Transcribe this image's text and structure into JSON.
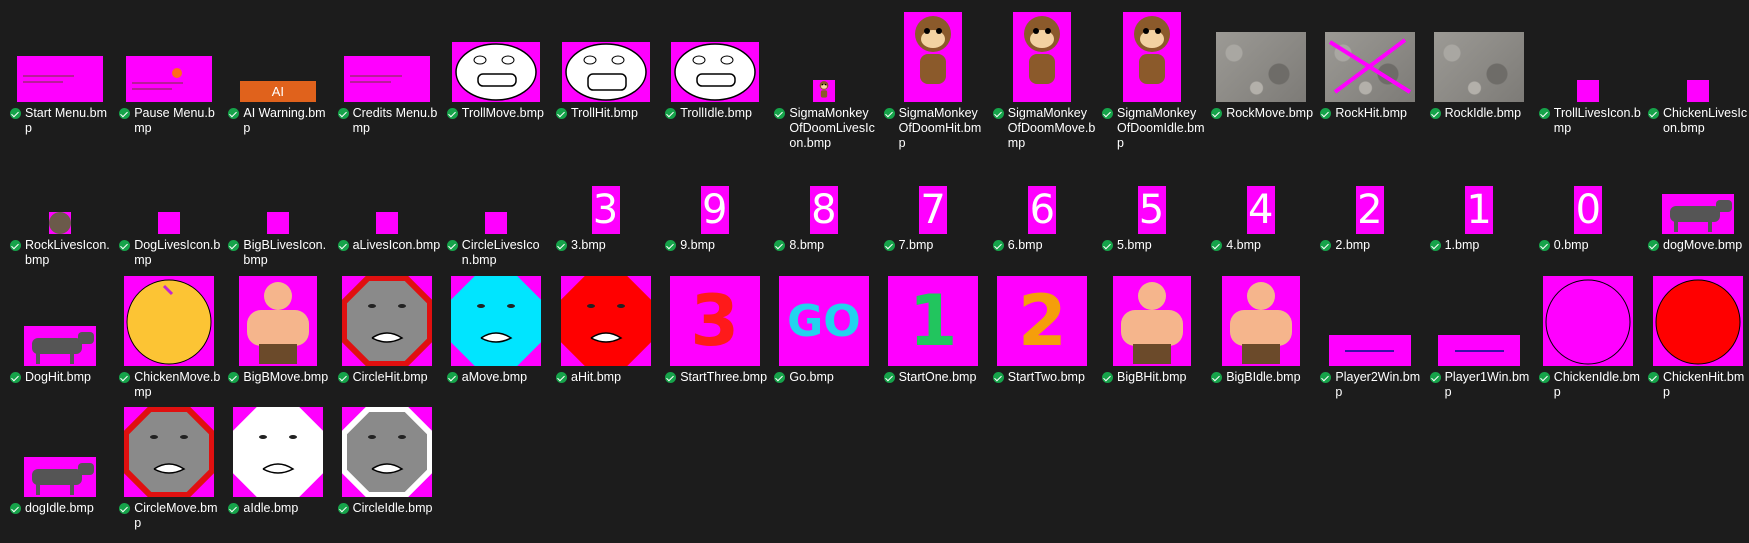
{
  "files": [
    {
      "name": "Start Menu.bmp",
      "thumb": "menu"
    },
    {
      "name": "Pause Menu.bmp",
      "thumb": "pause"
    },
    {
      "name": "AI Warning.bmp",
      "thumb": "ai-warning",
      "text": "AI"
    },
    {
      "name": "Credits Menu.bmp",
      "thumb": "credits"
    },
    {
      "name": "TrollMove.bmp",
      "thumb": "troll"
    },
    {
      "name": "TrollHit.bmp",
      "thumb": "troll-hit"
    },
    {
      "name": "TrollIdle.bmp",
      "thumb": "troll"
    },
    {
      "name": "SigmaMonkeyOfDoomLivesIcon.bmp",
      "thumb": "monkey-small"
    },
    {
      "name": "SigmaMonkeyOfDoomHit.bmp",
      "thumb": "monkey"
    },
    {
      "name": "SigmaMonkeyOfDoomMove.bmp",
      "thumb": "monkey"
    },
    {
      "name": "SigmaMonkeyOfDoomIdle.bmp",
      "thumb": "monkey"
    },
    {
      "name": "RockMove.bmp",
      "thumb": "rock"
    },
    {
      "name": "RockHit.bmp",
      "thumb": "rock-hit"
    },
    {
      "name": "RockIdle.bmp",
      "thumb": "rock"
    },
    {
      "name": "TrollLivesIcon.bmp",
      "thumb": "small"
    },
    {
      "name": "ChickenLivesIcon.bmp",
      "thumb": "small"
    },
    {
      "name": "RockLivesIcon.bmp",
      "thumb": "small-rock"
    },
    {
      "name": "DogLivesIcon.bmp",
      "thumb": "small"
    },
    {
      "name": "BigBLivesIcon.bmp",
      "thumb": "small"
    },
    {
      "name": "aLivesIcon.bmp",
      "thumb": "small"
    },
    {
      "name": "CircleLivesIcon.bmp",
      "thumb": "small"
    },
    {
      "name": "3.bmp",
      "thumb": "digit",
      "text": "3"
    },
    {
      "name": "9.bmp",
      "thumb": "digit",
      "text": "9"
    },
    {
      "name": "8.bmp",
      "thumb": "digit",
      "text": "8"
    },
    {
      "name": "7.bmp",
      "thumb": "digit",
      "text": "7"
    },
    {
      "name": "6.bmp",
      "thumb": "digit",
      "text": "6"
    },
    {
      "name": "5.bmp",
      "thumb": "digit",
      "text": "5"
    },
    {
      "name": "4.bmp",
      "thumb": "digit",
      "text": "4"
    },
    {
      "name": "2.bmp",
      "thumb": "digit",
      "text": "2"
    },
    {
      "name": "1.bmp",
      "thumb": "digit",
      "text": "1"
    },
    {
      "name": "0.bmp",
      "thumb": "digit",
      "text": "0"
    },
    {
      "name": "dogMove.bmp",
      "thumb": "dog"
    },
    {
      "name": "DogHit.bmp",
      "thumb": "dog"
    },
    {
      "name": "ChickenMove.bmp",
      "thumb": "chicken"
    },
    {
      "name": "BigBMove.bmp",
      "thumb": "bigb"
    },
    {
      "name": "CircleHit.bmp",
      "thumb": "circle-red"
    },
    {
      "name": "aMove.bmp",
      "thumb": "octa-cyan"
    },
    {
      "name": "aHit.bmp",
      "thumb": "octa-red"
    },
    {
      "name": "StartThree.bmp",
      "thumb": "big-text",
      "text": "3",
      "color": "#ff1a1a"
    },
    {
      "name": "Go.bmp",
      "thumb": "big-text",
      "text": "GO",
      "color": "#22d3ee"
    },
    {
      "name": "StartOne.bmp",
      "thumb": "big-text",
      "text": "1",
      "color": "#22c55e"
    },
    {
      "name": "StartTwo.bmp",
      "thumb": "big-text",
      "text": "2",
      "color": "#f59e0b"
    },
    {
      "name": "BigBHit.bmp",
      "thumb": "bigb"
    },
    {
      "name": "BigBIdle.bmp",
      "thumb": "bigb"
    },
    {
      "name": "Player2Win.bmp",
      "thumb": "banner"
    },
    {
      "name": "Player1Win.bmp",
      "thumb": "banner"
    },
    {
      "name": "ChickenIdle.bmp",
      "thumb": "chicken-magenta"
    },
    {
      "name": "ChickenHit.bmp",
      "thumb": "chicken-red"
    },
    {
      "name": "dogIdle.bmp",
      "thumb": "dog"
    },
    {
      "name": "CircleMove.bmp",
      "thumb": "circle-red"
    },
    {
      "name": "aIdle.bmp",
      "thumb": "octa-white"
    },
    {
      "name": "CircleIdle.bmp",
      "thumb": "circle-white"
    }
  ]
}
